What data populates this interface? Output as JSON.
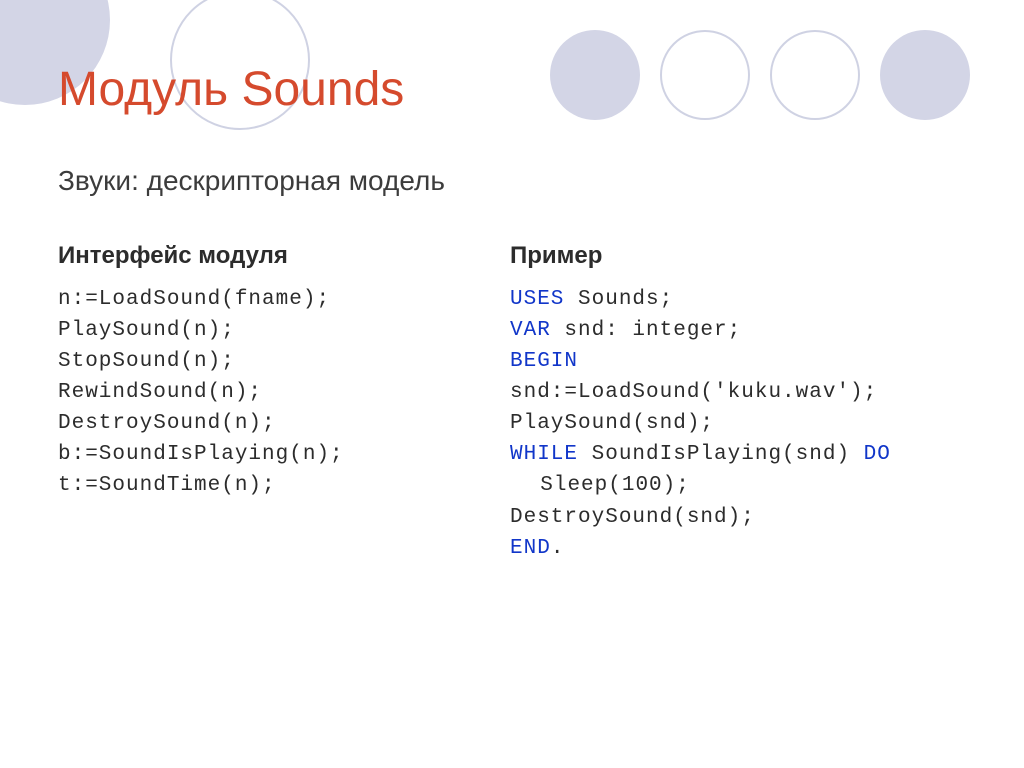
{
  "title": "Модуль Sounds",
  "subtitle": "Звуки: дескрипторная модель",
  "left": {
    "heading": "Интерфейс модуля",
    "lines": {
      "l0": "n:=LoadSound(fname);",
      "l1": "PlaySound(n);",
      "l2": "StopSound(n);",
      "l3": "RewindSound(n);",
      "l4": "DestroySound(n);",
      "l5": "b:=SoundIsPlaying(n);",
      "l6": "t:=SoundTime(n);"
    }
  },
  "right": {
    "heading": "Пример",
    "kw": {
      "uses": "uses",
      "var": "var",
      "begin": "begin",
      "while": "while",
      "do": "do",
      "end": "end"
    },
    "txt": {
      "uses_rest": " Sounds;",
      "var_rest": " snd: integer;",
      "ln_load": "snd:=LoadSound('kuku.wav');",
      "ln_play": "PlaySound(snd);",
      "while_mid": " SoundIsPlaying(snd) ",
      "ln_sleep": "Sleep(100);",
      "ln_destroy": "DestroySound(snd);",
      "end_punct": "."
    }
  }
}
